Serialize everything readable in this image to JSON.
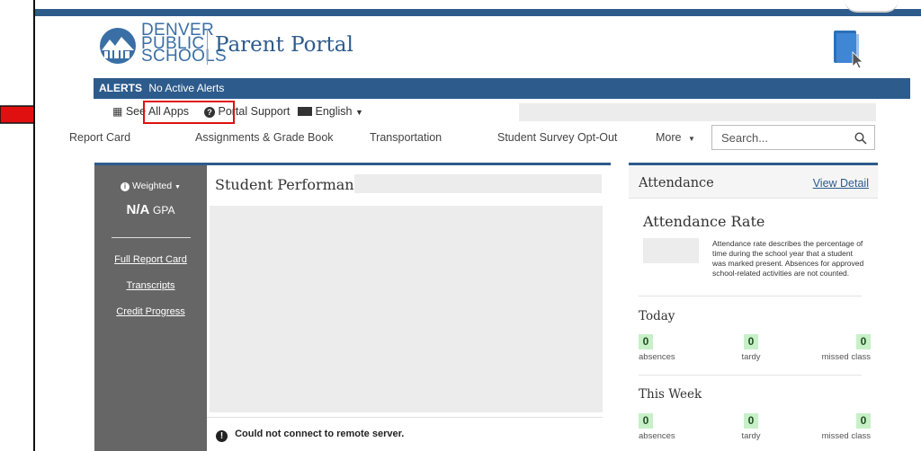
{
  "header": {
    "logo_lines": [
      "DENVER",
      "PUBLIC",
      "SCHOOLS"
    ],
    "title": "Parent Portal"
  },
  "alerts": {
    "label": "ALERTS",
    "message": "No Active Alerts"
  },
  "toolbar": {
    "see_all_apps": "See All Apps",
    "portal_support": "Portal Support",
    "language": "English"
  },
  "nav": {
    "items": [
      "Report Card",
      "Assignments & Grade Book",
      "Transportation",
      "Student Survey Opt-Out"
    ],
    "more": "More",
    "search_placeholder": "Search..."
  },
  "left_panel": {
    "weighted": "Weighted",
    "gpa_value": "N/A",
    "gpa_label": "GPA",
    "links": [
      "Full Report Card",
      "Transcripts",
      "Credit Progress"
    ]
  },
  "performance": {
    "title": "Student Performance",
    "separator": "|",
    "error": "Could not connect to remote server."
  },
  "attendance": {
    "title": "Attendance",
    "view_detail": "View Detail",
    "rate_title": "Attendance Rate",
    "rate_description": "Attendance rate describes the percentage of time during the school year that a student was marked present. Absences for approved school-related activities are not counted.",
    "today": {
      "title": "Today",
      "absences": "0",
      "absences_label": "absences",
      "tardy": "0",
      "tardy_label": "tardy",
      "missed": "0",
      "missed_label": "missed class"
    },
    "week": {
      "title": "This Week",
      "absences": "0",
      "absences_label": "absences",
      "tardy": "0",
      "tardy_label": "tardy",
      "missed": "0",
      "missed_label": "missed class"
    }
  },
  "colors": {
    "brand": "#2d5b8c",
    "annotation": "#e01010",
    "stat_bg": "#c8f0c8"
  }
}
